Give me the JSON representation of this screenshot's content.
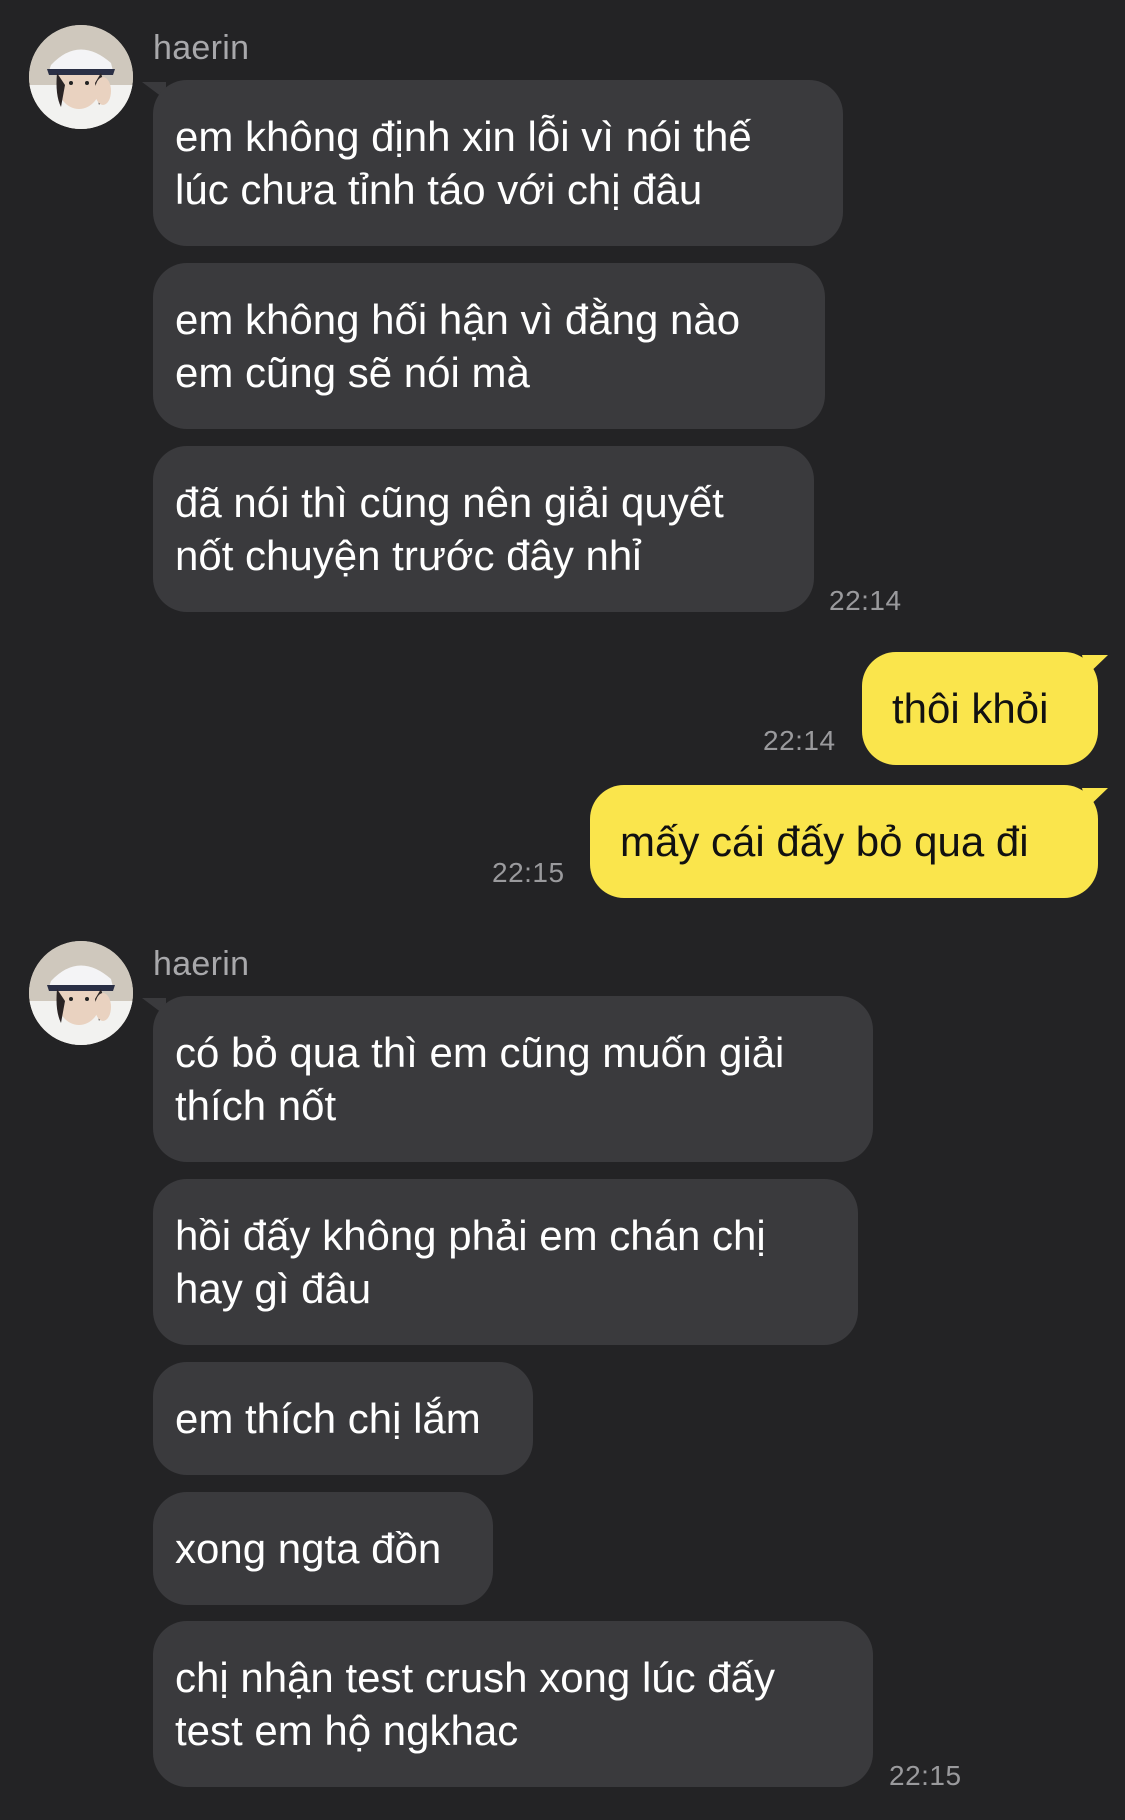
{
  "conversation": {
    "group1": {
      "sender": "haerin",
      "messages": [
        "em không định xin lỗi vì nói thế\nlúc chưa tỉnh táo với chị đâu",
        "em không hối hận vì đằng nào\nem cũng sẽ nói mà",
        "đã nói thì cũng nên giải quyết\nnốt chuyện trước đây nhỉ"
      ],
      "time": "22:14"
    },
    "outgoing": [
      {
        "text": "thôi khỏi",
        "time": "22:14"
      },
      {
        "text": "mấy cái đấy bỏ qua đi",
        "time": "22:15"
      }
    ],
    "group2": {
      "sender": "haerin",
      "messages": [
        "có bỏ qua thì em cũng muốn giải\nthích nốt",
        "hồi đấy không phải em chán chị\nhay gì đâu",
        "em thích chị lắm",
        "xong ngta đồn",
        "chị nhận test crush xong lúc đấy\ntest em hộ ngkhac"
      ],
      "time": "22:15"
    }
  },
  "colors": {
    "background": "#232325",
    "incoming_bubble": "#3a3a3d",
    "outgoing_bubble": "#fae54c"
  },
  "icons": {
    "avatar": "user-avatar-photo"
  }
}
